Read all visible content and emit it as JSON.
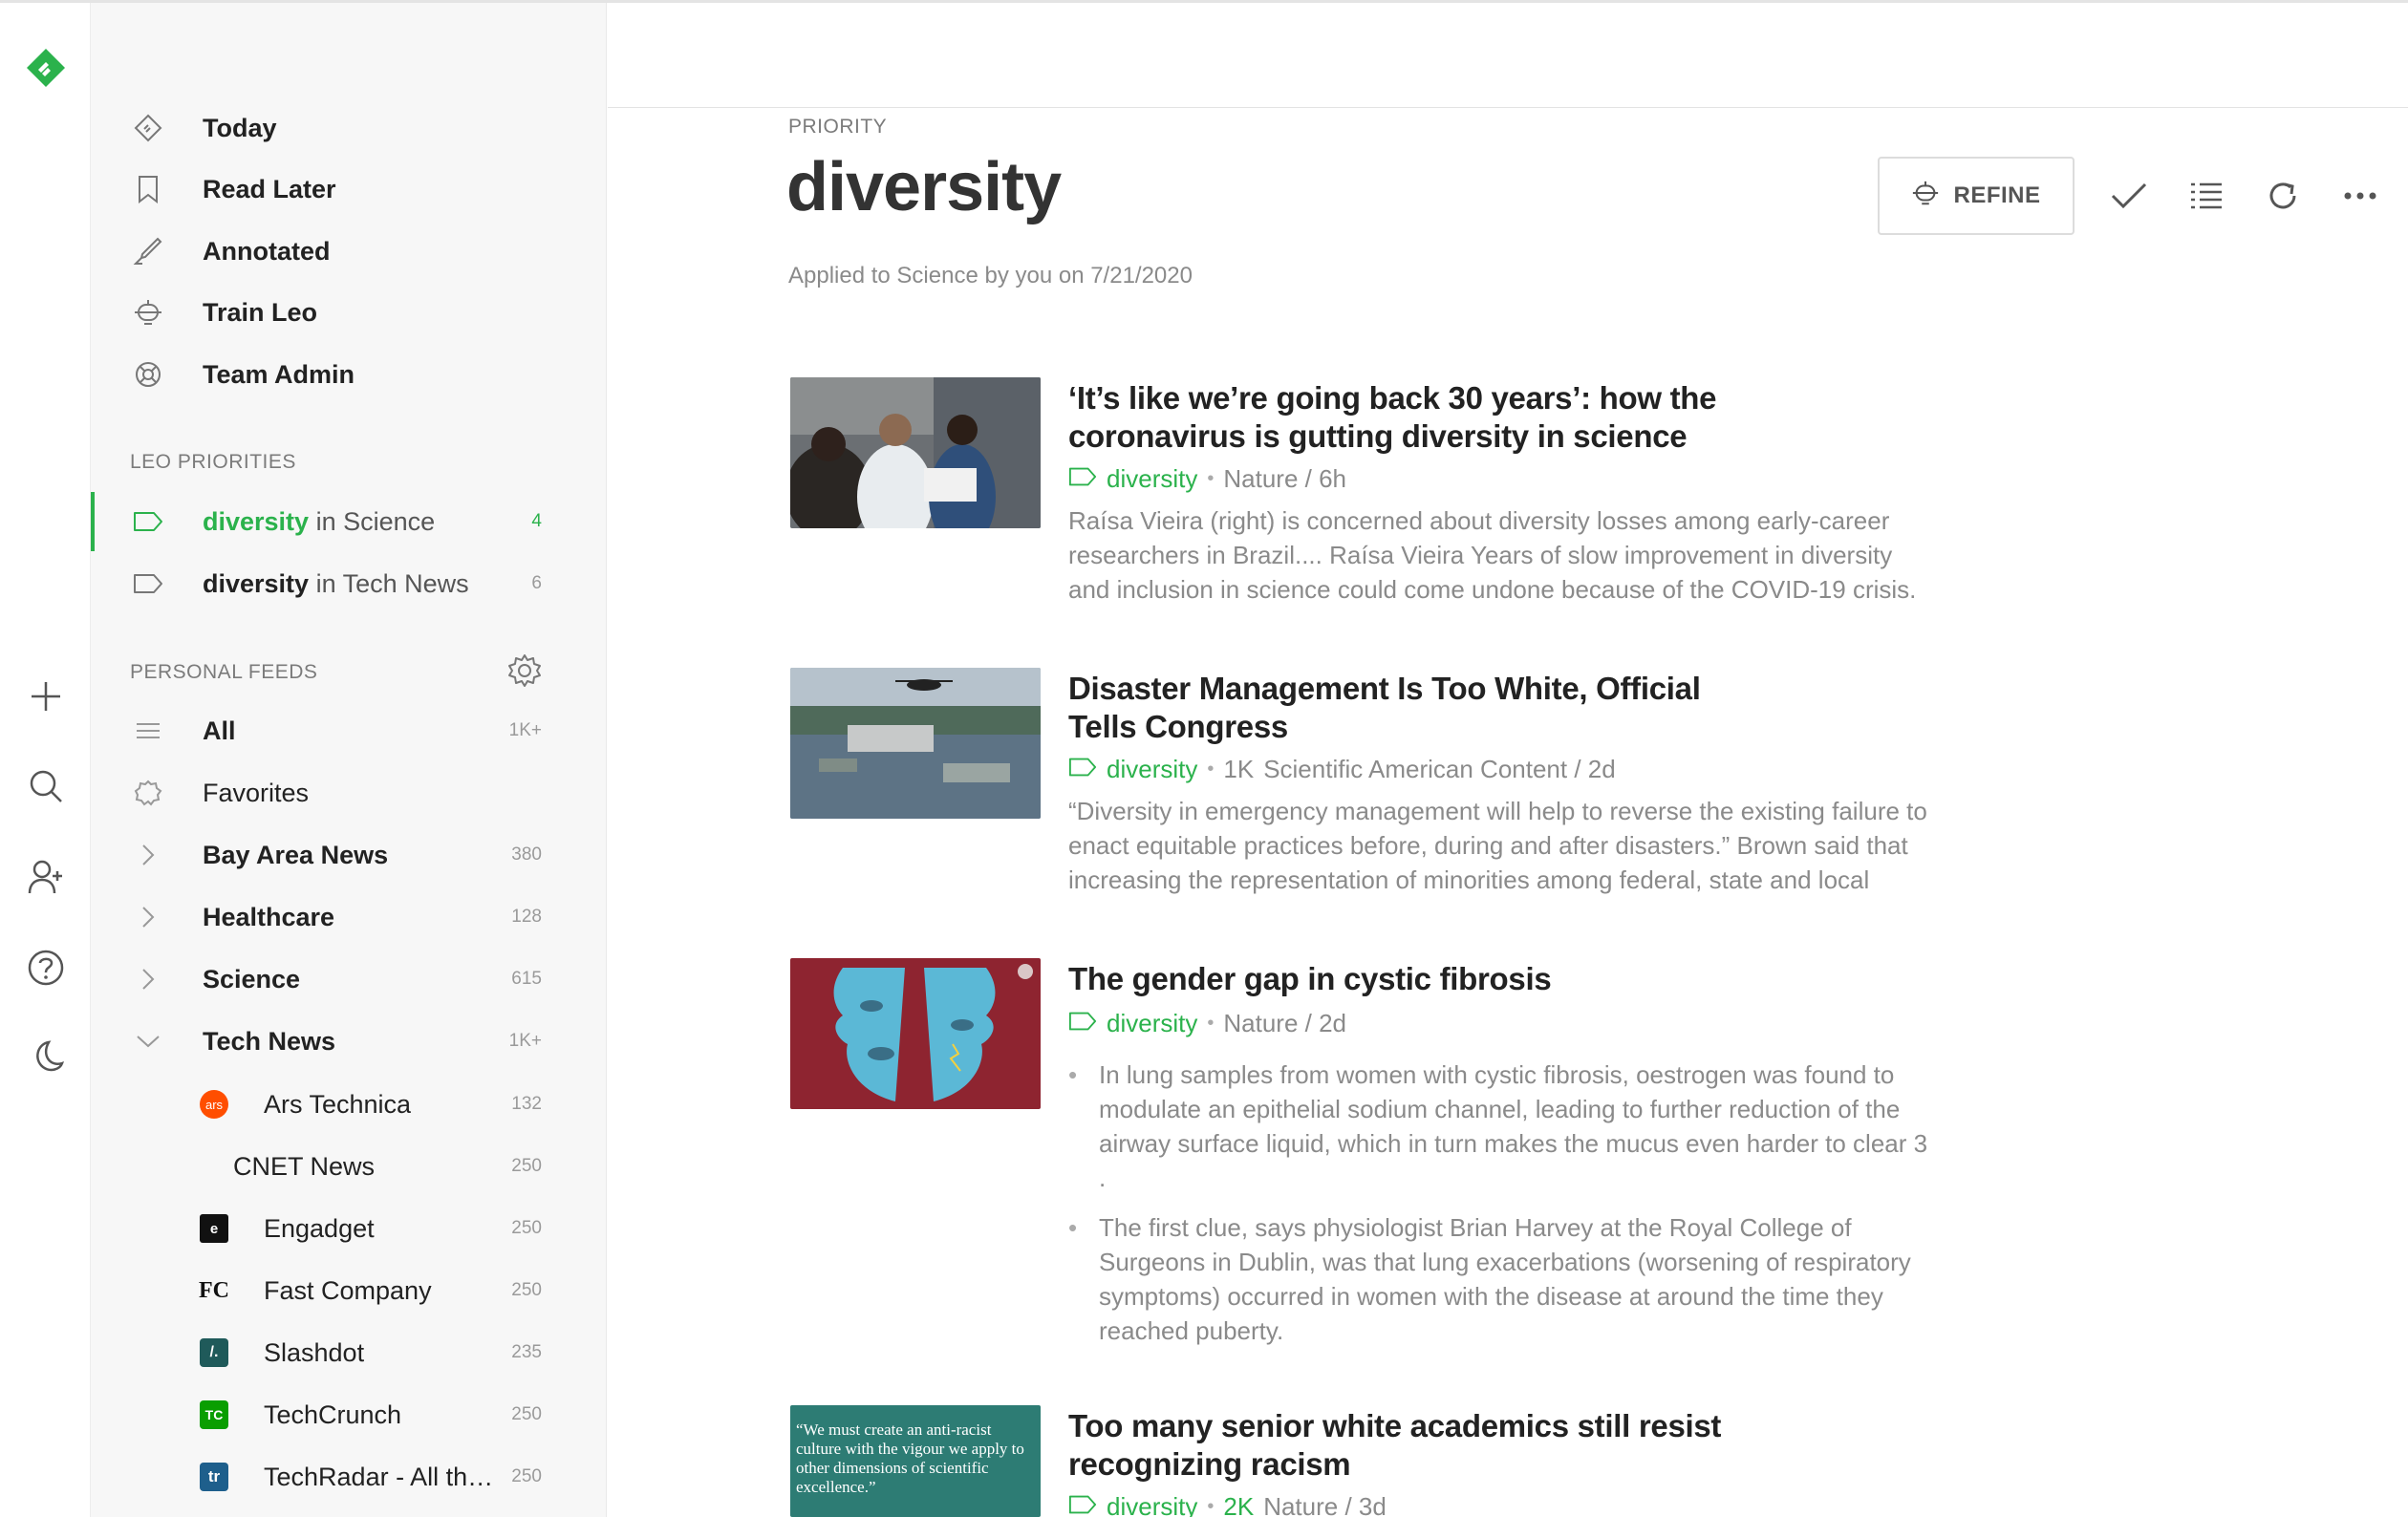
{
  "colors": {
    "accent": "#2bb24c",
    "nav_bg": "#f7f7f7",
    "text": "#222222",
    "muted": "#8a8a8a"
  },
  "nav": {
    "primary": [
      {
        "label": "Today",
        "icon": "today-icon"
      },
      {
        "label": "Read Later",
        "icon": "bookmark-icon"
      },
      {
        "label": "Annotated",
        "icon": "highlighter-icon"
      },
      {
        "label": "Train Leo",
        "icon": "robot-icon"
      },
      {
        "label": "Team Admin",
        "icon": "lifebuoy-icon"
      }
    ],
    "leo_priorities_label": "LEO PRIORITIES",
    "priorities": [
      {
        "keyword": "diversity",
        "scope": "in Science",
        "count": "4",
        "active": true
      },
      {
        "keyword": "diversity",
        "scope": "in Tech News",
        "count": "6",
        "active": false
      }
    ],
    "personal_feeds_label": "PERSONAL FEEDS",
    "feeds": [
      {
        "label": "All",
        "count": "1K+"
      },
      {
        "label": "Favorites",
        "count": ""
      },
      {
        "label": "Bay Area News",
        "count": "380"
      },
      {
        "label": "Healthcare",
        "count": "128"
      },
      {
        "label": "Science",
        "count": "615"
      },
      {
        "label": "Tech News",
        "count": "1K+"
      }
    ],
    "tech_sources": [
      {
        "label": "Ars Technica",
        "count": "132",
        "favicon": "ars"
      },
      {
        "label": "CNET News",
        "count": "250",
        "favicon": ""
      },
      {
        "label": "Engadget",
        "count": "250",
        "favicon": "e"
      },
      {
        "label": "Fast Company",
        "count": "250",
        "favicon": "FC"
      },
      {
        "label": "Slashdot",
        "count": "235",
        "favicon": "/."
      },
      {
        "label": "TechCrunch",
        "count": "250",
        "favicon": "TC"
      },
      {
        "label": "TechRadar - All th…",
        "count": "250",
        "favicon": "tr"
      }
    ]
  },
  "main": {
    "eyebrow": "PRIORITY",
    "title": "diversity",
    "subtitle": "Applied to Science by you on 7/21/2020",
    "refine_label": "REFINE"
  },
  "articles": [
    {
      "title": "‘It’s like we’re going back 30 years’: how the coronavirus is gutting diversity in science",
      "tag": "diversity",
      "engagement": "",
      "source": "Nature / 6h",
      "summary": "Raísa Vieira (right) is concerned about diversity losses among early-career researchers in Brazil.... Raísa Vieira Years of slow improvement in diversity and inclusion in science could come undone because of the COVID-19 crisis."
    },
    {
      "title": "Disaster Management Is Too White, Official Tells Congress",
      "tag": "diversity",
      "engagement": "1K",
      "source": "Scientific American Content / 2d",
      "summary": "“Diversity in emergency management will help to reverse the existing failure to enact equitable practices before, during and after disasters.” Brown said that increasing the representation of minorities among federal, state and local"
    },
    {
      "title": "The gender gap in cystic fibrosis",
      "tag": "diversity",
      "engagement": "",
      "source": "Nature / 2d",
      "bullets": [
        "In lung samples from women with cystic fibrosis, oestrogen was found to modulate an epithelial sodium channel, leading to further reduction of the airway surface liquid, which in turn makes the mucus even harder to clear 3 .",
        "The first clue, says physiologist Brian Harvey at the Royal College of Surgeons in Dublin, was that lung exacerbations (worsening of respiratory symptoms) occurred in women with the disease at around the time they reached puberty."
      ]
    },
    {
      "title": "Too many senior white academics still resist recognizing racism",
      "tag": "diversity",
      "engagement": "2K",
      "source": "Nature / 3d",
      "thumb_quote": "“We must create an anti-racist culture with the vigour we apply to other dimensions of scientific excellence.”"
    }
  ]
}
